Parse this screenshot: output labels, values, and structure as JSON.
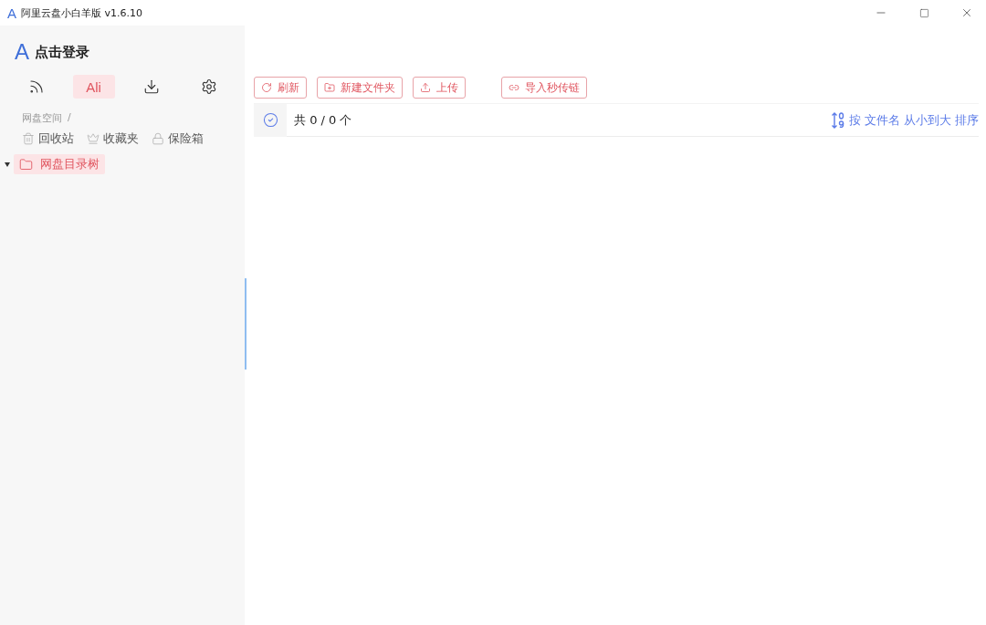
{
  "window": {
    "title": "阿里云盘小白羊版 v1.6.10",
    "logo": "A"
  },
  "sidebar": {
    "login": {
      "logo": "A",
      "label": "点击登录"
    },
    "tabs": [
      {
        "kind": "feed",
        "selected": false
      },
      {
        "kind": "text",
        "label": "Ali",
        "selected": true
      },
      {
        "kind": "download",
        "selected": false
      },
      {
        "kind": "settings",
        "selected": false
      }
    ],
    "breadcrumb": [
      "网盘空间",
      "/"
    ],
    "quick_links": [
      {
        "kind": "trash",
        "label": "回收站"
      },
      {
        "kind": "favorites",
        "label": "收藏夹"
      },
      {
        "kind": "safe",
        "label": "保险箱"
      }
    ],
    "tree": [
      {
        "label": "网盘目录树",
        "expanded": true,
        "selected": true
      }
    ]
  },
  "toolbar": [
    {
      "kind": "refresh",
      "label": "刷新"
    },
    {
      "kind": "new-folder",
      "label": "新建文件夹"
    },
    {
      "kind": "upload",
      "label": "上传"
    },
    {
      "kind": "link",
      "label": "导入秒传链"
    }
  ],
  "list_header": {
    "count": "共 0 / 0 个",
    "sort": "按 文件名 从小到大 排序"
  }
}
